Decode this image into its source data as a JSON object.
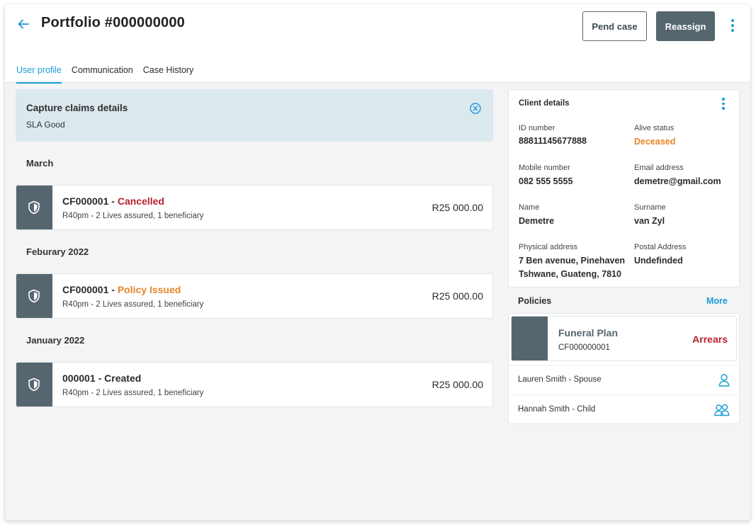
{
  "header": {
    "title": "Portfolio #000000000",
    "pend_label": "Pend case",
    "reassign_label": "Reassign"
  },
  "tabs": [
    {
      "label": "User profile",
      "active": true
    },
    {
      "label": "Communication",
      "active": false
    },
    {
      "label": "Case History",
      "active": false
    }
  ],
  "banner": {
    "title": "Capture claims details",
    "subtitle": "SLA Good"
  },
  "timeline": [
    {
      "month": "March",
      "case": {
        "id": "CF000001",
        "status": "Cancelled",
        "status_color": "#b5222e",
        "summary": "R40pm - 2 Lives assured, 1 beneficiary",
        "amount": "R25 000.00"
      }
    },
    {
      "month": "Feburary 2022",
      "case": {
        "id": "CF000001",
        "status": "Policy Issued",
        "status_color": "#e5862a",
        "summary": "R40pm - 2 Lives assured, 1 beneficiary",
        "amount": "R25 000.00"
      }
    },
    {
      "month": "January 2022",
      "case": {
        "id": "000001",
        "status": "Created",
        "status_color": "#2b2b2b",
        "summary": "R40pm - 2 Lives assured, 1 beneficiary",
        "amount": "R25 000.00"
      }
    }
  ],
  "client": {
    "title": "Client details",
    "id_label": "ID number",
    "id_value": "88811145677888",
    "alive_label": "Alive status",
    "alive_value": "Deceased",
    "mobile_label": "Mobile number",
    "mobile_value": "082 555 5555",
    "email_label": "Email address",
    "email_value": "demetre@gmail.com",
    "name_label": "Name",
    "name_value": "Demetre",
    "surname_label": "Surname",
    "surname_value": "van Zyl",
    "physical_label": "Physical address",
    "physical_line1": "7 Ben avenue, Pinehaven",
    "physical_line2": "Tshwane, Guateng, 7810",
    "postal_label": "Postal Address",
    "postal_value": "Undefinded"
  },
  "policies": {
    "label": "Policies",
    "more_label": "More",
    "plan": {
      "name": "Funeral Plan",
      "code": "CF000000001",
      "status": "Arrears"
    },
    "members": [
      {
        "name": "Lauren Smith - Spouse",
        "icon": "person-icon"
      },
      {
        "name": "Hannah Smith - Child",
        "icon": "people-icon"
      }
    ]
  },
  "colors": {
    "accent": "#1a9bd7",
    "slate": "#56666f",
    "banner_bg": "#dbe9ee",
    "cancelled": "#b5222e",
    "issued": "#e5862a",
    "arrears": "#b5222e",
    "deceased": "#e5862a"
  }
}
